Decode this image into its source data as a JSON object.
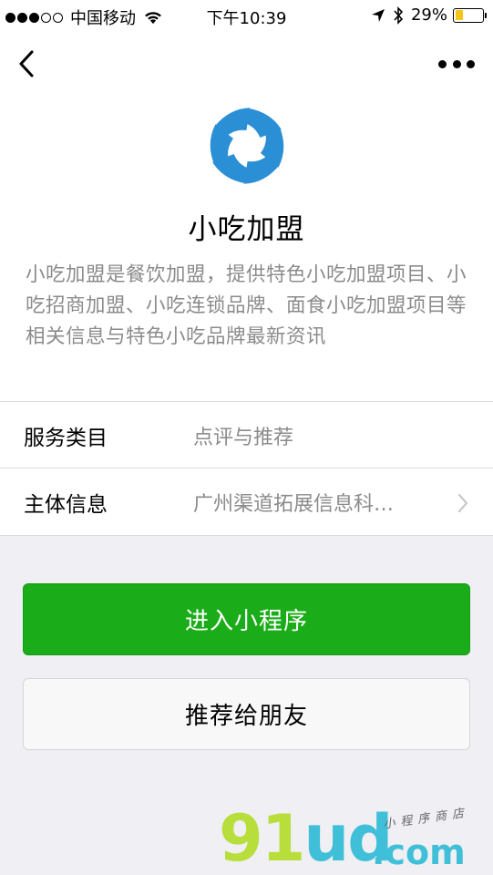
{
  "status_bar": {
    "carrier": "中国移动",
    "time": "下午10:39",
    "battery_percent": "29%",
    "battery_level": 0.29,
    "battery_color": "#f5c518"
  },
  "nav": {
    "back_icon": "chevron-left-icon",
    "more_icon": "more-dots-icon"
  },
  "app": {
    "name": "小吃加盟",
    "description": "小吃加盟是餐饮加盟，提供特色小吃加盟项目、小吃招商加盟、小吃连锁品牌、面食小吃加盟项目等相关信息与特色小吃品牌最新资讯",
    "logo_color": "#2b8fd6"
  },
  "info": {
    "rows": [
      {
        "label": "服务类目",
        "value": "点评与推荐"
      },
      {
        "label": "主体信息",
        "value": "广州渠道拓展信息科…"
      }
    ]
  },
  "actions": {
    "enter_label": "进入小程序",
    "enter_color": "#1aad19",
    "share_label": "推荐给朋友"
  },
  "watermark": {
    "main_a": "91",
    "main_b": "ud",
    "domain": ".com",
    "tagline": "小程序商店"
  }
}
